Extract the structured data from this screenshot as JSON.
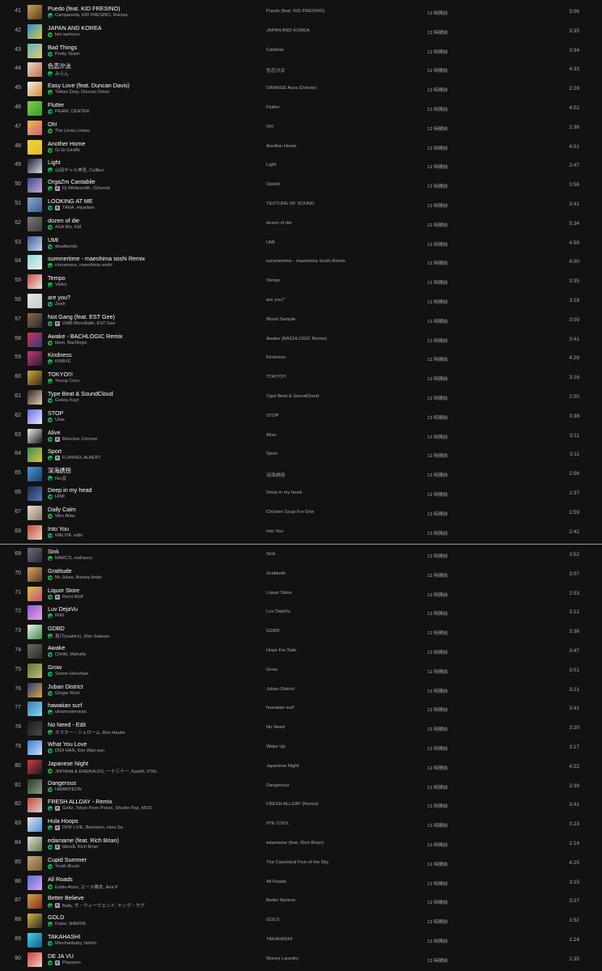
{
  "added_label": "12 時間前",
  "blocks": [
    [
      {
        "n": "41",
        "title": "Puedo (feat. KID FRESINO)",
        "artist": "Campanella, KID FRESINO, Ramza",
        "explicit": false,
        "album": "Puedo (feat. KID FRESINO)",
        "dur": "3:06",
        "c1": "#c8a55a",
        "c2": "#5a3a1a"
      },
      {
        "n": "42",
        "title": "JAPAN AND KOREA",
        "artist": "kim taehoon",
        "explicit": false,
        "album": "JAPAN AND KOREA",
        "dur": "3:35",
        "c1": "#2f8fd6",
        "c2": "#d8c84a"
      },
      {
        "n": "43",
        "title": "Bad Things",
        "artist": "Pretty Sister",
        "explicit": false,
        "album": "Catalina",
        "dur": "3:34",
        "c1": "#5fb4c9",
        "c2": "#e6c86b"
      },
      {
        "n": "44",
        "title": "色恋沙汰",
        "artist": "みらん",
        "explicit": false,
        "album": "色恋沙汰",
        "dur": "4:33",
        "c1": "#e8ddd0",
        "c2": "#c66a4a"
      },
      {
        "n": "45",
        "title": "Easy Love (feat. Duncan Davis)",
        "artist": "Tobias Dray, Duncan Davis",
        "explicit": false,
        "album": "ORANGE Aura (Deluxe)",
        "dur": "2:28",
        "c1": "#f2f2f2",
        "c2": "#d48a2c"
      },
      {
        "n": "46",
        "title": "Flutter",
        "artist": "PEARL CENTER",
        "explicit": false,
        "album": "Flutter",
        "dur": "4:02",
        "c1": "#7ad14a",
        "c2": "#3a9a2a"
      },
      {
        "n": "47",
        "title": "Oh!",
        "artist": "The Linda Lindas",
        "explicit": false,
        "album": "Oh!",
        "dur": "2:36",
        "c1": "#e8c43a",
        "c2": "#d05a8a"
      },
      {
        "n": "48",
        "title": "Another Home",
        "artist": "Gi Gi Giraffe",
        "explicit": false,
        "album": "Another Home",
        "dur": "4:01",
        "c1": "#f0d43a",
        "c2": "#e8b82a"
      },
      {
        "n": "49",
        "title": "Light",
        "artist": "山田ギャル神宮, Cuffboi",
        "explicit": false,
        "album": "Light",
        "dur": "2:47",
        "c1": "#1a1a2a",
        "c2": "#d8d8e8"
      },
      {
        "n": "50",
        "title": "OrgaZm Cantabile",
        "artist": "Dj Whitesmith, OZworld",
        "explicit": true,
        "album": "Opioid",
        "dur": "3:56",
        "c1": "#3a4a8a",
        "c2": "#c8a8d8"
      },
      {
        "n": "51",
        "title": "LOOKING AT ME",
        "artist": "TANA, Hiyadam",
        "explicit": true,
        "album": "TEXTURE OF SOUND",
        "dur": "3:41",
        "c1": "#8aaad8",
        "c2": "#3a5a8a"
      },
      {
        "n": "52",
        "title": "dozen of die",
        "artist": "ASA Wu, KM",
        "explicit": false,
        "album": "dozen of die",
        "dur": "5:34",
        "c1": "#7a7a7a",
        "c2": "#3a3a3a"
      },
      {
        "n": "53",
        "title": "UMI",
        "artist": "deadbundy",
        "explicit": false,
        "album": "UMI",
        "dur": "4:59",
        "c1": "#3a5a9a",
        "c2": "#c8d8f0"
      },
      {
        "n": "54",
        "title": "summertime - maeshima soshi Remix",
        "artist": "cinnamons, maeshima soshi",
        "explicit": false,
        "album": "summertime - maeshima Soshi Remix",
        "dur": "4:00",
        "c1": "#8ad8d8",
        "c2": "#f0f0f0"
      },
      {
        "n": "55",
        "title": "Tempo",
        "artist": "Valley",
        "explicit": false,
        "album": "Tempo",
        "dur": "3:35",
        "c1": "#c84a4a",
        "c2": "#f0e8e0"
      },
      {
        "n": "56",
        "title": "are you?",
        "artist": "Zeph",
        "explicit": false,
        "album": "are you?",
        "dur": "3:18",
        "c1": "#e8e8e8",
        "c2": "#c8c8c8"
      },
      {
        "n": "57",
        "title": "Not Gang (feat. EST Gee)",
        "artist": "OMB Bloodbath, EST Gee",
        "explicit": true,
        "album": "Blood Sample",
        "dur": "3:09",
        "c1": "#8a6a4a",
        "c2": "#2a2a2a"
      },
      {
        "n": "58",
        "title": "Awake - BACHLOGIC Remix",
        "artist": "idom, Bachlogic",
        "explicit": false,
        "album": "Awake (BACHLOGIC Remix)",
        "dur": "3:41",
        "c1": "#d8324a",
        "c2": "#2a3a8a"
      },
      {
        "n": "59",
        "title": "Kindness",
        "artist": "KWAYE",
        "explicit": false,
        "album": "Kindness",
        "dur": "4:28",
        "c1": "#c83a6a",
        "c2": "#2a1a3a"
      },
      {
        "n": "60",
        "title": "TOKYO!!!",
        "artist": "Young Coco",
        "explicit": false,
        "album": "TOKYO!!!",
        "dur": "3:16",
        "c1": "#d8a83a",
        "c2": "#3a2a1a"
      },
      {
        "n": "61",
        "title": "Type Beat & SoundCloud",
        "artist": "Gokou Kuyt",
        "explicit": false,
        "album": "Type Beat & SoundCloud",
        "dur": "2:00",
        "c1": "#2a2a2a",
        "c2": "#e8c8a8"
      },
      {
        "n": "62",
        "title": "STOP",
        "artist": "Utae",
        "explicit": false,
        "album": "STOP",
        "dur": "3:38",
        "c1": "#6a6af0",
        "c2": "#e8e8ff"
      },
      {
        "n": "63",
        "title": "Alive",
        "artist": "Bleecker Chrome",
        "explicit": true,
        "album": "Alive",
        "dur": "3:11",
        "c1": "#f0f0f0",
        "c2": "#1a1a1a"
      },
      {
        "n": "64",
        "title": "Sport",
        "artist": "FLANNEL ALBERT",
        "explicit": true,
        "album": "Sport",
        "dur": "3:11",
        "c1": "#3a8a5a",
        "c2": "#d8c83a"
      },
      {
        "n": "65",
        "title": "深海誘拐",
        "artist": "Rin音",
        "explicit": false,
        "album": "深海誘拐",
        "dur": "2:56",
        "c1": "#4a9ad8",
        "c2": "#1a3a6a"
      },
      {
        "n": "66",
        "title": "Deep in my head",
        "artist": "HIMI",
        "explicit": false,
        "album": "Deep in my head",
        "dur": "2:37",
        "c1": "#1a2a4a",
        "c2": "#5a7ab8"
      },
      {
        "n": "67",
        "title": "Daily Calm",
        "artist": "Wez Atlas",
        "explicit": false,
        "album": "Chicken Soup For One",
        "dur": "2:59",
        "c1": "#e8e0d0",
        "c2": "#8a7a6a"
      },
      {
        "n": "68",
        "title": "Into You",
        "artist": "MALIYA, edbl",
        "explicit": false,
        "album": "Into You",
        "dur": "2:42",
        "c1": "#c84a3a",
        "c2": "#e8d0b8"
      }
    ],
    [
      {
        "n": "69",
        "title": "Sink",
        "artist": "MARCS, niafrasco",
        "explicit": false,
        "album": "Sink",
        "dur": "3:52",
        "c1": "#6a6a7a",
        "c2": "#2a2a3a"
      },
      {
        "n": "70",
        "title": "Gratitude",
        "artist": "Mr Jukes, Barney Artist",
        "explicit": false,
        "album": "Gratitude",
        "dur": "3:07",
        "c1": "#d8a85a",
        "c2": "#5a3a2a"
      },
      {
        "n": "71",
        "title": "Liquor Store",
        "artist": "Remi Wolf",
        "explicit": true,
        "album": "Liquor Store",
        "dur": "2:53",
        "c1": "#d8c83a",
        "c2": "#c84a8a"
      },
      {
        "n": "72",
        "title": "Luv DejaVu",
        "artist": "RIRI",
        "explicit": false,
        "album": "Luv DejaVu",
        "dur": "3:12",
        "c1": "#8a5ad8",
        "c2": "#e8a8d8"
      },
      {
        "n": "73",
        "title": "GDBD",
        "artist": "真汗(mahiro), Shin Sakiura",
        "explicit": false,
        "album": "GDBD",
        "dur": "3:36",
        "c1": "#f0f0f0",
        "c2": "#3a8a4a"
      },
      {
        "n": "74",
        "title": "Awake",
        "artist": "Chiiild, Mahalia",
        "explicit": false,
        "album": "Hope For Sale",
        "dur": "3:47",
        "c1": "#6a6a5a",
        "c2": "#2a2a2a"
      },
      {
        "n": "75",
        "title": "Grow",
        "artist": "Samm Henshaw",
        "explicit": false,
        "album": "Grow",
        "dur": "3:01",
        "c1": "#5a7a3a",
        "c2": "#c8b87a"
      },
      {
        "n": "76",
        "title": "Juban District",
        "artist": "Ginger Root",
        "explicit": false,
        "album": "Juban District",
        "dur": "3:21",
        "c1": "#2a3a7a",
        "c2": "#d8a83a"
      },
      {
        "n": "77",
        "title": "hawaiian surf",
        "artist": "ultramodernista",
        "explicit": false,
        "album": "hawaiian surf",
        "dur": "3:41",
        "c1": "#3a7ab8",
        "c2": "#8ad8e8"
      },
      {
        "n": "78",
        "title": "No Need - Edit",
        "artist": "オスカー・ジェローム, Ben Hauke",
        "explicit": false,
        "album": "No Need",
        "dur": "3:20",
        "c1": "#1a1a1a",
        "c2": "#4a4a4a"
      },
      {
        "n": "79",
        "title": "What You Love",
        "artist": "DIDI HAN, Kim Wan-sun",
        "explicit": false,
        "album": "Wake Up",
        "dur": "3:17",
        "c1": "#3a7ad8",
        "c2": "#c8e0f8"
      },
      {
        "n": "80",
        "title": "Japanese Night",
        "artist": "JINTANA & EMERALDS, 一十三十一, Kashif, XTAL",
        "explicit": false,
        "album": "Japanese Night",
        "dur": "4:22",
        "c1": "#d83a3a",
        "c2": "#1a1a2a"
      },
      {
        "n": "81",
        "title": "Dangerous",
        "artist": "HWARYEON",
        "explicit": false,
        "album": "Dangerous",
        "dur": "3:39",
        "c1": "#2a3a2a",
        "c2": "#8a9a8a"
      },
      {
        "n": "82",
        "title": "FRESH ALLDAY - Remix",
        "artist": "Gottz, Tokyo Pose Posse, Shurkn Pap, MUD",
        "explicit": true,
        "album": "FRESH ALLDAY (Remix)",
        "dur": "3:41",
        "c1": "#c84a3a",
        "c2": "#d8d0c8"
      },
      {
        "n": "83",
        "title": "Hula Hoops",
        "artist": "DPR LIVE, Beenzino, Hwa Sa",
        "explicit": true,
        "album": "IITE COOL",
        "dur": "3:23",
        "c1": "#e8e8e8",
        "c2": "#4a8ad8"
      },
      {
        "n": "84",
        "title": "edamame (feat. Rich Brian)",
        "artist": "bbno$, Rich Brian",
        "explicit": true,
        "album": "edamame (feat. Rich Brian)",
        "dur": "2:14",
        "c1": "#e8e0d8",
        "c2": "#5a7a4a"
      },
      {
        "n": "85",
        "title": "Cupid Summer",
        "artist": "Youth Brush",
        "explicit": false,
        "album": "The Canonical Five of the Sky",
        "dur": "4:25",
        "c1": "#c8a87a",
        "c2": "#7a5a3a"
      },
      {
        "n": "86",
        "title": "All Roads",
        "artist": "Eddie Atom, エース橋本, Aria P",
        "explicit": false,
        "album": "All Roads",
        "dur": "3:15",
        "c1": "#5a6ad8",
        "c2": "#d8a8e8"
      },
      {
        "n": "87",
        "title": "Better Believe",
        "artist": "Belly, ザ・ウィークエンド, ヤング・サグ",
        "explicit": true,
        "album": "Better Believe",
        "dur": "3:27",
        "c1": "#c8a83a",
        "c2": "#8a2a2a"
      },
      {
        "n": "88",
        "title": "GOLD",
        "artist": "Kojoe, NARISK",
        "explicit": false,
        "album": "GOLD",
        "dur": "3:52",
        "c1": "#d8b83a",
        "c2": "#2a2a2a"
      },
      {
        "n": "89",
        "title": "TAKAHASHI",
        "artist": "Minchanbaby, hirihiri",
        "explicit": false,
        "album": "TAKAHASHI",
        "dur": "1:24",
        "c1": "#3ad8e8",
        "c2": "#1a5a8a"
      },
      {
        "n": "90",
        "title": "DE JA VU",
        "artist": "Playsson",
        "explicit": true,
        "album": "Money Laundry",
        "dur": "2:35",
        "c1": "#d83a3a",
        "c2": "#f0d0c8"
      }
    ]
  ]
}
